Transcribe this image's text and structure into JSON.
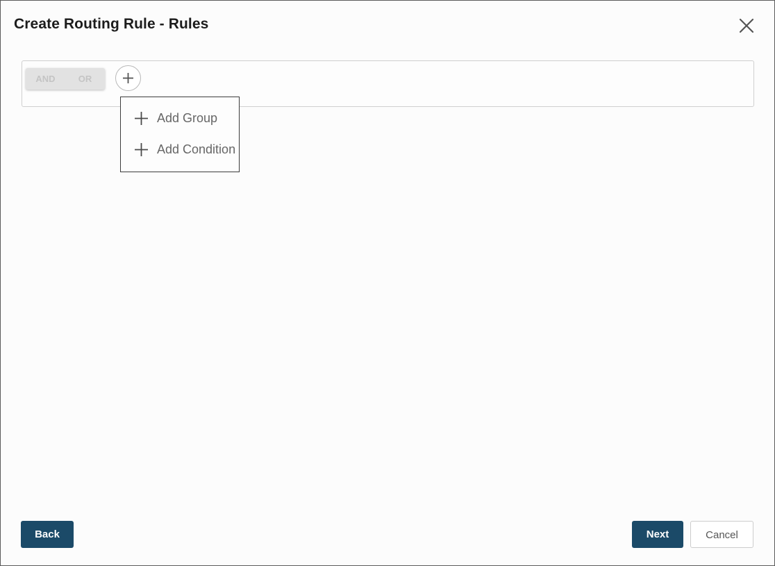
{
  "dialog": {
    "title": "Create Routing Rule - Rules",
    "close_icon": "close-icon"
  },
  "rule_builder": {
    "toggle": {
      "and_label": "AND",
      "or_label": "OR"
    },
    "add_icon": "plus-icon"
  },
  "add_menu": {
    "items": [
      {
        "label": "Add Group",
        "icon": "plus-icon"
      },
      {
        "label": "Add Condition",
        "icon": "plus-icon"
      }
    ]
  },
  "footer": {
    "back_label": "Back",
    "next_label": "Next",
    "cancel_label": "Cancel"
  },
  "colors": {
    "primary": "#1b4a68",
    "toggle_bg": "#e2e2e2",
    "menu_text": "#666666"
  }
}
